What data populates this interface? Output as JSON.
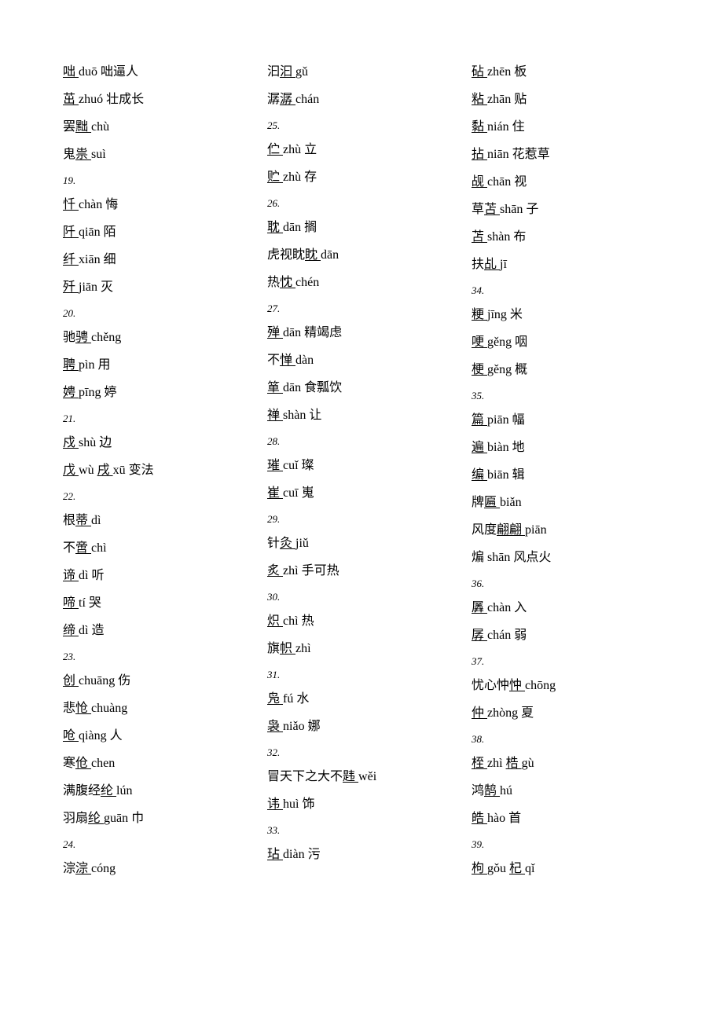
{
  "columns": [
    [
      {
        "type": "entry",
        "parts": [
          {
            "t": "咄 ",
            "u": true
          },
          {
            "t": "duō 咄逼人"
          }
        ]
      },
      {
        "type": "entry",
        "parts": [
          {
            "t": "茁 ",
            "u": true
          },
          {
            "t": "zhuó 壮成长"
          }
        ]
      },
      {
        "type": "entry",
        "parts": [
          {
            "t": "罢"
          },
          {
            "t": "黜 ",
            "u": true
          },
          {
            "t": "chù"
          }
        ]
      },
      {
        "type": "entry",
        "parts": [
          {
            "t": "鬼"
          },
          {
            "t": "祟 ",
            "u": true
          },
          {
            "t": "suì"
          }
        ]
      },
      {
        "type": "num",
        "t": "19."
      },
      {
        "type": "entry",
        "parts": [
          {
            "t": "忏 ",
            "u": true
          },
          {
            "t": "chàn 悔"
          }
        ]
      },
      {
        "type": "entry",
        "parts": [
          {
            "t": "阡 ",
            "u": true
          },
          {
            "t": "qiān 陌"
          }
        ]
      },
      {
        "type": "entry",
        "parts": [
          {
            "t": "纤 ",
            "u": true
          },
          {
            "t": "xiān 细"
          }
        ]
      },
      {
        "type": "entry",
        "parts": [
          {
            "t": "歼 ",
            "u": true
          },
          {
            "t": "jiān 灭"
          }
        ]
      },
      {
        "type": "num",
        "t": "20."
      },
      {
        "type": "entry",
        "parts": [
          {
            "t": "驰"
          },
          {
            "t": "骋 ",
            "u": true
          },
          {
            "t": "chěng"
          }
        ]
      },
      {
        "type": "entry",
        "parts": [
          {
            "t": "聘 ",
            "u": true
          },
          {
            "t": "pìn 用"
          }
        ]
      },
      {
        "type": "entry",
        "parts": [
          {
            "t": "娉 ",
            "u": true
          },
          {
            "t": "pīng 婷"
          }
        ]
      },
      {
        "type": "num",
        "t": "21."
      },
      {
        "type": "entry",
        "parts": [
          {
            "t": "戍 ",
            "u": true
          },
          {
            "t": "shù 边"
          }
        ]
      },
      {
        "type": "entry",
        "parts": [
          {
            "t": "戊 ",
            "u": true
          },
          {
            "t": "wù "
          },
          {
            "t": "戌 ",
            "u": true
          },
          {
            "t": "xū 变法"
          }
        ]
      },
      {
        "type": "num",
        "t": "22."
      },
      {
        "type": "entry",
        "parts": [
          {
            "t": "根"
          },
          {
            "t": "蒂 ",
            "u": true
          },
          {
            "t": "dì"
          }
        ]
      },
      {
        "type": "entry",
        "parts": [
          {
            "t": "不"
          },
          {
            "t": "啻 ",
            "u": true
          },
          {
            "t": "chì"
          }
        ]
      },
      {
        "type": "entry",
        "parts": [
          {
            "t": "谛 ",
            "u": true
          },
          {
            "t": "dì 听"
          }
        ]
      },
      {
        "type": "entry",
        "parts": [
          {
            "t": "啼 ",
            "u": true
          },
          {
            "t": "tí 哭"
          }
        ]
      },
      {
        "type": "entry",
        "parts": [
          {
            "t": "缔 ",
            "u": true
          },
          {
            "t": "dì 造"
          }
        ]
      },
      {
        "type": "num",
        "t": "23."
      },
      {
        "type": "entry",
        "parts": [
          {
            "t": "创 ",
            "u": true
          },
          {
            "t": "chuāng 伤"
          }
        ]
      },
      {
        "type": "entry",
        "parts": [
          {
            "t": "悲"
          },
          {
            "t": "怆 ",
            "u": true
          },
          {
            "t": "chuàng"
          }
        ]
      },
      {
        "type": "entry",
        "parts": [
          {
            "t": "呛 ",
            "u": true
          },
          {
            "t": "qiàng 人"
          }
        ]
      },
      {
        "type": "entry",
        "parts": [
          {
            "t": "寒"
          },
          {
            "t": "伧 ",
            "u": true
          },
          {
            "t": "chen"
          }
        ]
      },
      {
        "type": "entry",
        "parts": [
          {
            "t": "满腹经"
          },
          {
            "t": "纶 ",
            "u": true
          },
          {
            "t": "lún"
          }
        ]
      },
      {
        "type": "entry",
        "parts": [
          {
            "t": "羽扇"
          },
          {
            "t": "纶 ",
            "u": true
          },
          {
            "t": "guān 巾"
          }
        ]
      },
      {
        "type": "num",
        "t": "24."
      },
      {
        "type": "entry",
        "parts": [
          {
            "t": "淙"
          },
          {
            "t": "淙 ",
            "u": true
          },
          {
            "t": "cóng"
          }
        ]
      }
    ],
    [
      {
        "type": "entry",
        "parts": [
          {
            "t": "汩"
          },
          {
            "t": "汩 ",
            "u": true
          },
          {
            "t": "gǔ"
          }
        ]
      },
      {
        "type": "entry",
        "parts": [
          {
            "t": "潺"
          },
          {
            "t": "潺 ",
            "u": true
          },
          {
            "t": "chán"
          }
        ]
      },
      {
        "type": "num",
        "t": "25."
      },
      {
        "type": "entry",
        "parts": [
          {
            "t": "伫 ",
            "u": true
          },
          {
            "t": "zhù 立"
          }
        ]
      },
      {
        "type": "entry",
        "parts": [
          {
            "t": "贮 ",
            "u": true
          },
          {
            "t": "zhù 存"
          }
        ]
      },
      {
        "type": "num",
        "t": "26."
      },
      {
        "type": "entry",
        "parts": [
          {
            "t": "耽 ",
            "u": true
          },
          {
            "t": "dān 搁"
          }
        ]
      },
      {
        "type": "entry",
        "parts": [
          {
            "t": "虎视眈"
          },
          {
            "t": "眈 ",
            "u": true
          },
          {
            "t": "dān"
          }
        ]
      },
      {
        "type": "entry",
        "parts": [
          {
            "t": "热"
          },
          {
            "t": "忱 ",
            "u": true
          },
          {
            "t": "chén"
          }
        ]
      },
      {
        "type": "num",
        "t": "27."
      },
      {
        "type": "entry",
        "parts": [
          {
            "t": "殚 ",
            "u": true
          },
          {
            "t": "dān 精竭虑"
          }
        ]
      },
      {
        "type": "entry",
        "parts": [
          {
            "t": "不"
          },
          {
            "t": "惮 ",
            "u": true
          },
          {
            "t": "dàn"
          }
        ]
      },
      {
        "type": "entry",
        "parts": [
          {
            "t": "箪 ",
            "u": true
          },
          {
            "t": "dān 食瓢饮"
          }
        ]
      },
      {
        "type": "entry",
        "parts": [
          {
            "t": "禅 ",
            "u": true
          },
          {
            "t": "shàn 让"
          }
        ]
      },
      {
        "type": "num",
        "t": "28."
      },
      {
        "type": "entry",
        "parts": [
          {
            "t": "璀 ",
            "u": true
          },
          {
            "t": "cuǐ 璨"
          }
        ]
      },
      {
        "type": "entry",
        "parts": [
          {
            "t": "崔 ",
            "u": true
          },
          {
            "t": "cuī 嵬"
          }
        ]
      },
      {
        "type": "num",
        "t": "29."
      },
      {
        "type": "entry",
        "parts": [
          {
            "t": "针"
          },
          {
            "t": "灸 ",
            "u": true
          },
          {
            "t": "jiǔ"
          }
        ]
      },
      {
        "type": "entry",
        "parts": [
          {
            "t": "炙 ",
            "u": true
          },
          {
            "t": "zhì 手可热"
          }
        ]
      },
      {
        "type": "num",
        "t": "30."
      },
      {
        "type": "entry",
        "parts": [
          {
            "t": "炽 ",
            "u": true
          },
          {
            "t": "chì 热"
          }
        ]
      },
      {
        "type": "entry",
        "parts": [
          {
            "t": "旗"
          },
          {
            "t": "帜 ",
            "u": true
          },
          {
            "t": "zhì"
          }
        ]
      },
      {
        "type": "num",
        "t": "31."
      },
      {
        "type": "entry",
        "parts": [
          {
            "t": "凫 ",
            "u": true
          },
          {
            "t": "fú 水"
          }
        ]
      },
      {
        "type": "entry",
        "parts": [
          {
            "t": "袅 ",
            "u": true
          },
          {
            "t": "niǎo 娜"
          }
        ]
      },
      {
        "type": "num",
        "t": "32."
      },
      {
        "type": "entry",
        "parts": [
          {
            "t": "冒天下之大不"
          },
          {
            "t": "韪 ",
            "u": true
          },
          {
            "t": "wěi"
          }
        ]
      },
      {
        "type": "entry",
        "parts": [
          {
            "t": "讳 ",
            "u": true
          },
          {
            "t": "huì 饰"
          }
        ]
      },
      {
        "type": "num",
        "t": "33."
      },
      {
        "type": "entry",
        "parts": [
          {
            "t": "玷 ",
            "u": true
          },
          {
            "t": "diàn 污"
          }
        ]
      }
    ],
    [
      {
        "type": "entry",
        "parts": [
          {
            "t": "砧 ",
            "u": true
          },
          {
            "t": "zhēn 板"
          }
        ]
      },
      {
        "type": "entry",
        "parts": [
          {
            "t": "粘 ",
            "u": true
          },
          {
            "t": "zhān 贴"
          }
        ]
      },
      {
        "type": "entry",
        "parts": [
          {
            "t": "黏 ",
            "u": true
          },
          {
            "t": "nián 住"
          }
        ]
      },
      {
        "type": "entry",
        "parts": [
          {
            "t": "拈 ",
            "u": true
          },
          {
            "t": "niān 花惹草"
          }
        ]
      },
      {
        "type": "entry",
        "parts": [
          {
            "t": "觇 ",
            "u": true
          },
          {
            "t": "chān 视"
          }
        ]
      },
      {
        "type": "entry",
        "parts": [
          {
            "t": "草"
          },
          {
            "t": "苫 ",
            "u": true
          },
          {
            "t": "shān 子"
          }
        ]
      },
      {
        "type": "entry",
        "parts": [
          {
            "t": "苫 ",
            "u": true
          },
          {
            "t": "shàn 布"
          }
        ]
      },
      {
        "type": "entry",
        "parts": [
          {
            "t": "扶"
          },
          {
            "t": "乩 ",
            "u": true
          },
          {
            "t": "jī"
          }
        ]
      },
      {
        "type": "num",
        "t": "34."
      },
      {
        "type": "entry",
        "parts": [
          {
            "t": "粳 ",
            "u": true
          },
          {
            "t": "jīng 米"
          }
        ]
      },
      {
        "type": "entry",
        "parts": [
          {
            "t": "哽 ",
            "u": true
          },
          {
            "t": "gěng 咽"
          }
        ]
      },
      {
        "type": "entry",
        "parts": [
          {
            "t": "梗 ",
            "u": true
          },
          {
            "t": "gěng 概"
          }
        ]
      },
      {
        "type": "num",
        "t": "35."
      },
      {
        "type": "entry",
        "parts": [
          {
            "t": "篇 ",
            "u": true
          },
          {
            "t": "piān 幅"
          }
        ]
      },
      {
        "type": "entry",
        "parts": [
          {
            "t": "遍 ",
            "u": true
          },
          {
            "t": "biàn 地"
          }
        ]
      },
      {
        "type": "entry",
        "parts": [
          {
            "t": "编 ",
            "u": true
          },
          {
            "t": "biān 辑"
          }
        ]
      },
      {
        "type": "entry",
        "parts": [
          {
            "t": "牌"
          },
          {
            "t": "匾 ",
            "u": true
          },
          {
            "t": "biǎn"
          }
        ]
      },
      {
        "type": "entry",
        "parts": [
          {
            "t": "风度"
          },
          {
            "t": "翩翩 ",
            "u": true
          },
          {
            "t": "piān"
          }
        ]
      },
      {
        "type": "entry",
        "parts": [
          {
            "t": "煸 shān 风点火"
          }
        ]
      },
      {
        "type": "num",
        "t": "36."
      },
      {
        "type": "entry",
        "parts": [
          {
            "t": "羼 ",
            "u": true
          },
          {
            "t": "chàn 入"
          }
        ]
      },
      {
        "type": "entry",
        "parts": [
          {
            "t": "孱 ",
            "u": true
          },
          {
            "t": "chán 弱"
          }
        ]
      },
      {
        "type": "num",
        "t": "37."
      },
      {
        "type": "entry",
        "parts": [
          {
            "t": "忧心忡"
          },
          {
            "t": "忡 ",
            "u": true
          },
          {
            "t": "chōng"
          }
        ]
      },
      {
        "type": "entry",
        "parts": [
          {
            "t": "仲 ",
            "u": true
          },
          {
            "t": "zhòng 夏"
          }
        ]
      },
      {
        "type": "num",
        "t": "38."
      },
      {
        "type": "entry",
        "parts": [
          {
            "t": "桎 ",
            "u": true
          },
          {
            "t": "zhì "
          },
          {
            "t": "梏 ",
            "u": true
          },
          {
            "t": "gù"
          }
        ]
      },
      {
        "type": "entry",
        "parts": [
          {
            "t": "鸿"
          },
          {
            "t": "鹄 ",
            "u": true
          },
          {
            "t": "hú"
          }
        ]
      },
      {
        "type": "entry",
        "parts": [
          {
            "t": "皓 ",
            "u": true
          },
          {
            "t": "hào 首"
          }
        ]
      },
      {
        "type": "num",
        "t": "39."
      },
      {
        "type": "entry",
        "parts": [
          {
            "t": "枸 ",
            "u": true
          },
          {
            "t": "gǒu "
          },
          {
            "t": "杞 ",
            "u": true
          },
          {
            "t": "qǐ"
          }
        ]
      }
    ]
  ]
}
